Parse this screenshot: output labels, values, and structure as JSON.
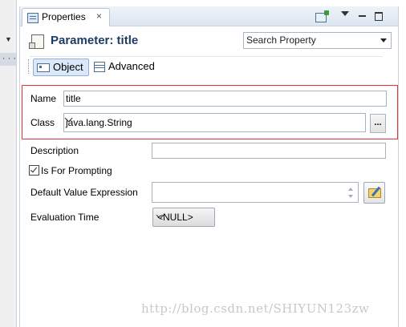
{
  "tab": {
    "title": "Properties",
    "close_glyph": "×"
  },
  "toolbar": {
    "icons": [
      "new-view-icon",
      "view-menu-icon",
      "minimize-icon",
      "maximize-icon"
    ]
  },
  "header": {
    "title": "Parameter: title",
    "search_value": "Search Property"
  },
  "subtabs": [
    {
      "label": "Object",
      "active": true
    },
    {
      "label": "Advanced",
      "active": false
    }
  ],
  "form": {
    "name_label": "Name",
    "name_value": "title",
    "class_label": "Class",
    "class_value": "java.lang.String",
    "browse_label": "...",
    "description_label": "Description",
    "description_value": "",
    "prompting_label": "Is For Prompting",
    "prompting_checked": true,
    "default_expr_label": "Default Value Expression",
    "default_expr_value": "",
    "eval_time_label": "Evaluation Time",
    "eval_time_value": "<NULL>"
  },
  "left_panel": {
    "dots": "· · ·"
  },
  "watermark": "http://blog.csdn.net/SHIYUN123zw",
  "colors": {
    "highlight_border": "#e0353b",
    "title_text": "#1d3c63",
    "active_tab_bg": "#dbe8f7"
  }
}
